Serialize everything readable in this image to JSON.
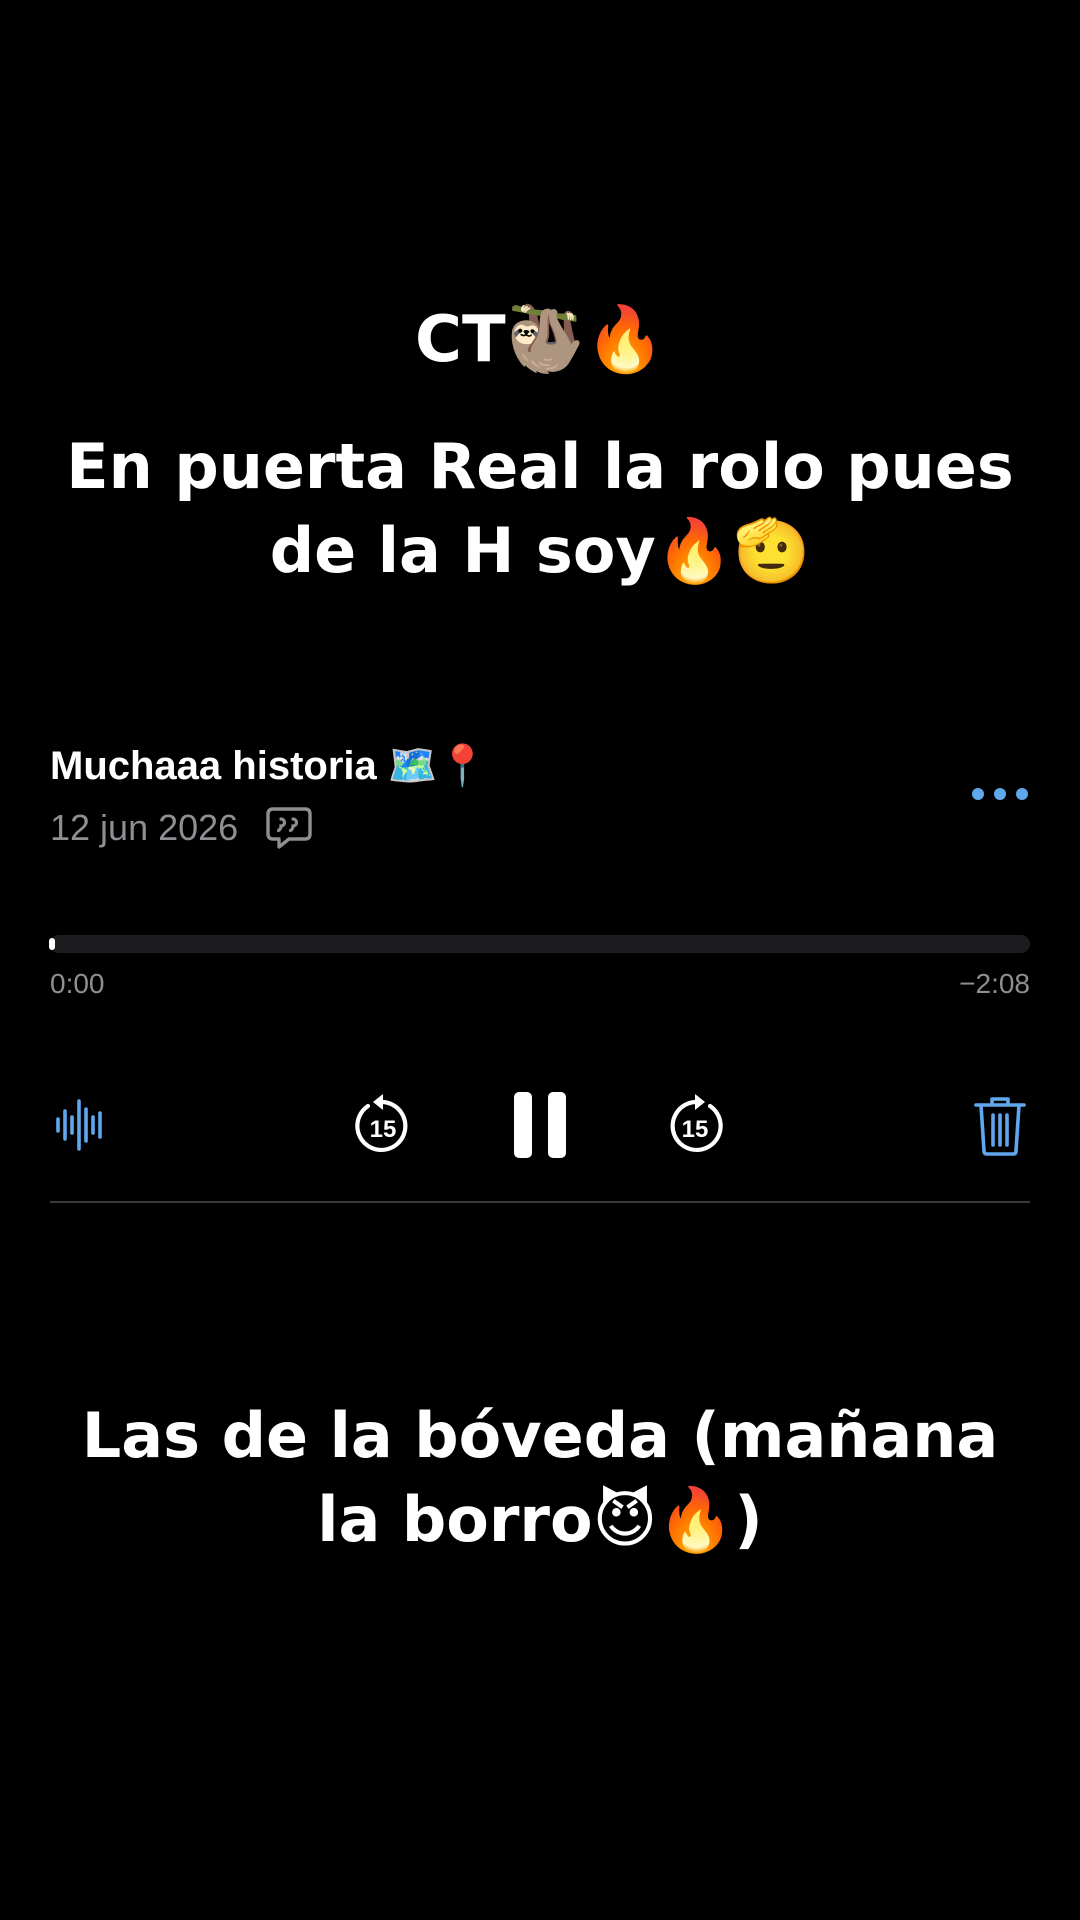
{
  "overlay": {
    "title": "CT🦥🔥",
    "caption_top": "En puerta Real la rolo pues de la H soy🔥🫡",
    "caption_bottom": "Las de la bóveda (mañana la borro😈🔥)"
  },
  "recording": {
    "title": "Muchaaa historia 🗺️📍",
    "date": "12 jun 2026",
    "transcript_icon": "quote-bubble-icon",
    "more_icon": "ellipsis-icon",
    "progress": 0.0,
    "elapsed": "0:00",
    "remaining": "−2:08"
  },
  "controls": {
    "waveform_icon": "waveform-icon",
    "skip_back_icon": "skip-back-15-icon",
    "skip_back_label": "15",
    "pause_icon": "pause-icon",
    "skip_forward_icon": "skip-forward-15-icon",
    "skip_forward_label": "15",
    "delete_icon": "trash-icon"
  },
  "colors": {
    "background": "#000000",
    "accent": "#5fa8ee",
    "secondary_text": "#8e8e93",
    "track": "#1c1c1e",
    "divider": "#3a3a3c"
  }
}
